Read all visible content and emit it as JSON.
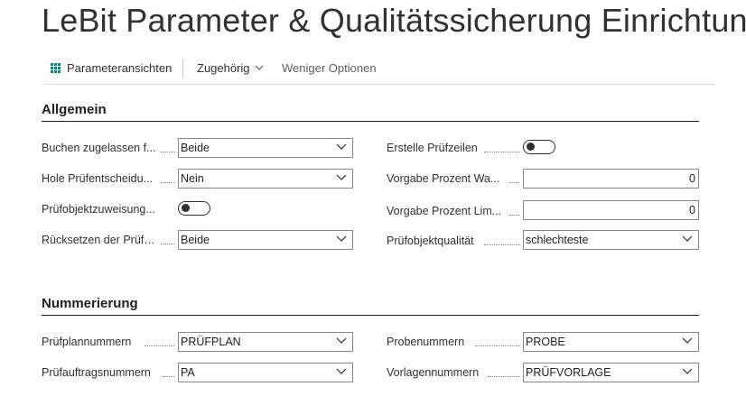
{
  "page": {
    "title": "LeBit Parameter & Qualitätssicherung Einrichtung"
  },
  "actions": {
    "parameteransichten": "Parameteransichten",
    "zugehoerig": "Zugehörig",
    "weniger_optionen": "Weniger Optionen"
  },
  "allgemein": {
    "title": "Allgemein",
    "buchen_label": "Buchen zugelassen f...",
    "buchen_value": "Beide",
    "hole_label": "Hole Prüfentscheidu...",
    "hole_value": "Nein",
    "zuweisung_label": "Prüfobjektzuweisung...",
    "zuweisung_value": false,
    "ruecksetzen_label": "Rücksetzen der Prüfe...",
    "ruecksetzen_value": "Beide",
    "erstelle_label": "Erstelle Prüfzeilen",
    "erstelle_value": false,
    "vorgabe_wa_label": "Vorgabe Prozent Wa...",
    "vorgabe_wa_value": "0",
    "vorgabe_lim_label": "Vorgabe Prozent Lim...",
    "vorgabe_lim_value": "0",
    "qualitaet_label": "Prüfobjektqualität",
    "qualitaet_value": "schlechteste"
  },
  "nummerierung": {
    "title": "Nummerierung",
    "pruefplan_label": "Prüfplannummern",
    "pruefplan_value": "PRÜFPLAN",
    "pruefauftrag_label": "Prüfauftragsnummern",
    "pruefauftrag_value": "PA",
    "proben_label": "Probenummern",
    "proben_value": "PROBE",
    "vorlagen_label": "Vorlagennummern",
    "vorlagen_value": "PRÜFVORLAGE"
  },
  "icons": {
    "views": "grid-icon",
    "dropdown": "chevron-down-icon",
    "toggle": "toggle-off"
  },
  "colors": {
    "accent": "#008489",
    "text": "#323130",
    "border": "#8a8886"
  }
}
